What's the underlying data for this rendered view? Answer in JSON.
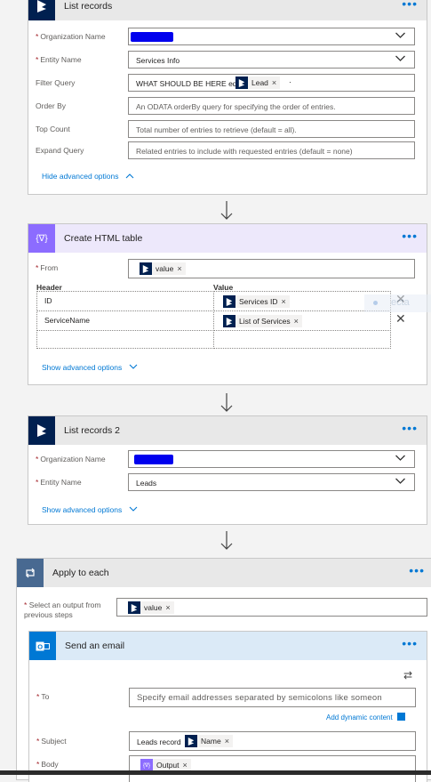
{
  "list_records": {
    "title": "List records",
    "org_label": "Organization Name",
    "entity_label": "Entity Name",
    "entity_value": "Services Info",
    "filter_label": "Filter Query",
    "filter_text": "WHAT SHOULD BE HERE eq'",
    "filter_token": "Lead",
    "filter_trailing": "·",
    "orderby_label": "Order By",
    "orderby_placeholder": "An ODATA orderBy query for specifying the order of entries.",
    "top_label": "Top Count",
    "top_placeholder": "Total number of entries to retrieve (default = all).",
    "expand_label": "Expand Query",
    "expand_placeholder": "Related entries to include with requested entries (default = none)",
    "hide_advanced": "Hide advanced options"
  },
  "html_table": {
    "title": "Create HTML table",
    "from_label": "From",
    "from_token": "value",
    "header_col": "Header",
    "value_col": "Value",
    "rows": [
      {
        "header": "ID",
        "value_token": "Services ID"
      },
      {
        "header": "ServiceName",
        "value_token": "List of Services"
      }
    ],
    "ghost_text": "ecta",
    "show_advanced": "Show advanced options"
  },
  "list_records_2": {
    "title": "List records 2",
    "org_label": "Organization Name",
    "entity_label": "Entity Name",
    "entity_value": "Leads",
    "show_advanced": "Show advanced options"
  },
  "apply_each": {
    "title": "Apply to each",
    "select_label_1": "Select an output from",
    "select_label_2": "previous steps",
    "select_token": "value"
  },
  "send_email": {
    "title": "Send an email",
    "to_label": "To",
    "to_placeholder": "Specify email addresses separated by semicolons like someon",
    "add_dynamic": "Add dynamic content",
    "subject_label": "Subject",
    "subject_text": "Leads record",
    "subject_token": "Name",
    "body_label": "Body",
    "body_token": "Output"
  },
  "icons": {
    "dynamics": "dynamics-365-icon",
    "data_ops": "data-operations-icon",
    "loop": "loop-icon",
    "outlook": "outlook-icon"
  },
  "colors": {
    "dynamics_badge": "#002050",
    "data_ops_badge": "#8c6cff",
    "loop_badge": "#486991",
    "outlook_badge": "#0078d4",
    "accent": "#0078d4",
    "required": "#a4262c"
  }
}
